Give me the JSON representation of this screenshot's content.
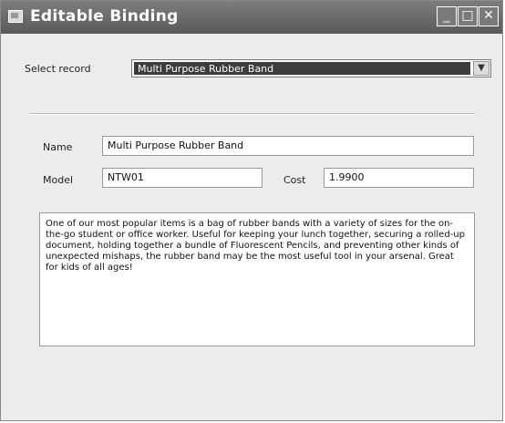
{
  "window": {
    "title": "Editable Binding",
    "minimize_glyph": "_",
    "maximize_glyph": "□",
    "close_glyph": "✕"
  },
  "form": {
    "select_label": "Select record",
    "selected_record": "Multi Purpose Rubber Band",
    "name_label": "Name",
    "name_value": "Multi Purpose Rubber Band",
    "model_label": "Model",
    "model_value": "NTW01",
    "cost_label": "Cost",
    "cost_value": "1.9900",
    "description": "One of our most popular items is a bag of rubber bands with a variety of sizes for the on-the-go student or office worker. Useful for keeping your lunch together, securing a rolled-up document, holding together a bundle of Fluorescent Pencils, and preventing other kinds of unexpected mishaps, the rubber band may be the most useful tool in your arsenal. Great for kids of all ages!"
  }
}
